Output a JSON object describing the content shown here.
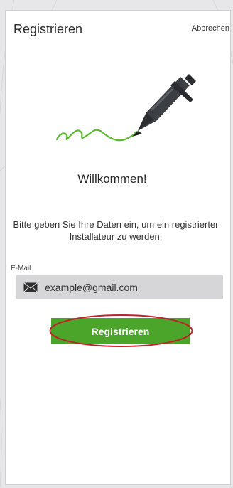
{
  "header": {
    "title": "Registrieren",
    "cancel_label": "Abbrechen"
  },
  "illustration": {
    "icon": "pen-signature-icon"
  },
  "main": {
    "welcome": "Willkommen!",
    "description": "Bitte geben Sie Ihre Daten ein, um ein registrierter Installateur zu werden.",
    "email_label": "E-Mail",
    "email_value": "example@gmail.com",
    "register_label": "Registrieren"
  },
  "colors": {
    "accent": "#4aa52a",
    "highlight": "#c0222a"
  }
}
